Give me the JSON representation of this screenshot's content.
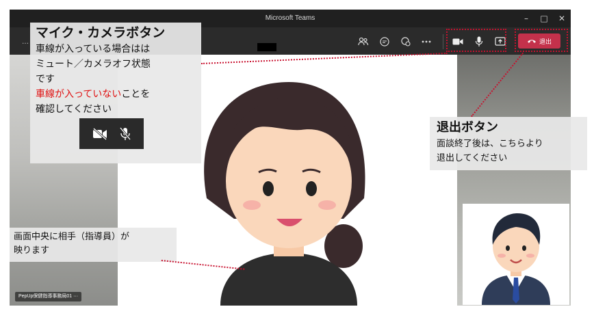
{
  "window": {
    "title": "Microsoft Teams",
    "controls": {
      "minimize": "–",
      "maximize": "□",
      "close": "✕"
    }
  },
  "toolbar": {
    "more_left": "…",
    "leave_label": "退出"
  },
  "participant": {
    "name_tag": "PepUp保健指導事務局01 ···"
  },
  "annotation_mic_camera": {
    "heading": "マイク・カメラボタン",
    "line1": "車線が入っている場合はは",
    "line2": "ミュート／カメラオフ状態",
    "line3": "です",
    "red_text": "車線が入っていない",
    "line4_rest": "ことを",
    "line5": "確認してください"
  },
  "annotation_leave": {
    "heading": "退出ボタン",
    "line1": "面談終了後は、こちらより",
    "line2": "退出してください"
  },
  "annotation_center": {
    "line1": "画面中央に相手（指導員）が",
    "line2": "映ります"
  },
  "colors": {
    "leave_button": "#c4314b",
    "callout_dots": "#c8102e",
    "highlight_text": "#e01010"
  }
}
